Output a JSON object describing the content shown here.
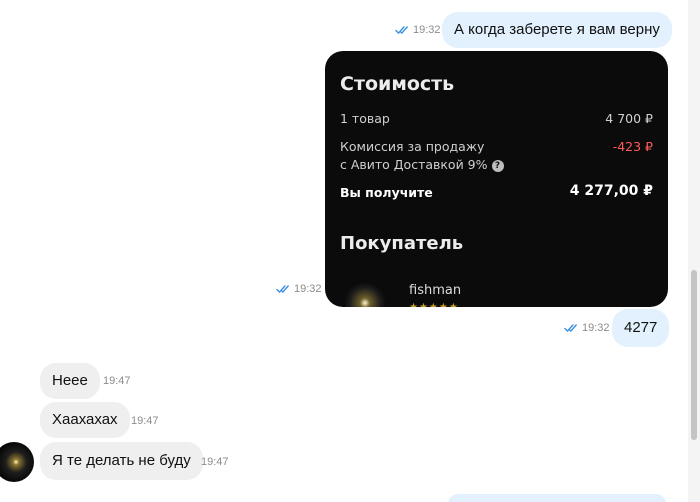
{
  "colors": {
    "outgoing_bubble": "#e2f1fd",
    "incoming_bubble": "#efefef",
    "read_check": "#3b8fe0",
    "time": "#8c8c8c"
  },
  "messages": {
    "m1": {
      "text": "А когда заберете я вам верну",
      "time": "19:32",
      "direction": "outgoing",
      "status_icon": "double-check-icon"
    },
    "m2": {
      "time": "19:32",
      "direction": "outgoing",
      "type": "image",
      "status_icon": "double-check-icon",
      "image": {
        "title": "Стоимость",
        "item_label": "1 товар",
        "item_value": "4 700 ₽",
        "commission_label_1": "Комиссия за продажу",
        "commission_label_2": "с Авито Доставкой 9%",
        "commission_help": "?",
        "commission_value": "-423 ₽",
        "total_label": "Вы получите",
        "total_value": "4 277,00 ₽",
        "buyer_title": "Покупатель",
        "buyer_name": "fishman",
        "buyer_rating": "★★★★★"
      }
    },
    "m3": {
      "text": "4277",
      "time": "19:32",
      "direction": "outgoing",
      "status_icon": "double-check-icon"
    },
    "m4": {
      "text": "Неее",
      "time": "19:47",
      "direction": "incoming"
    },
    "m5": {
      "text": "Хаахахах",
      "time": "19:47",
      "direction": "incoming"
    },
    "m6": {
      "text": "Я те делать не буду",
      "time": "19:47",
      "direction": "incoming"
    }
  }
}
